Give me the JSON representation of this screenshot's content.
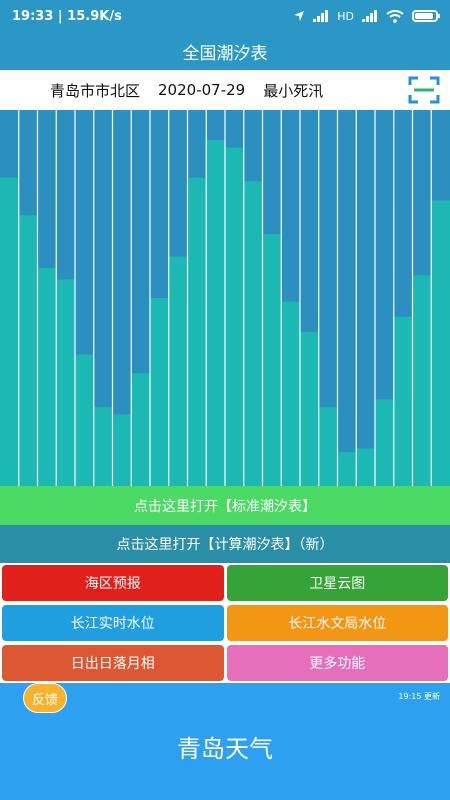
{
  "status": {
    "time_speed": "19:33 | 15.9K/s",
    "signal_text": "HD"
  },
  "app_title": "全国潮汐表",
  "info": {
    "location": "青岛市市北区",
    "date": "2020-07-29",
    "tide_type": "最小死汛"
  },
  "chart_data": {
    "type": "bar",
    "stacked": true,
    "bar_count": 24,
    "tide_levels": [
      0.82,
      0.72,
      0.58,
      0.55,
      0.35,
      0.21,
      0.19,
      0.3,
      0.5,
      0.61,
      0.82,
      0.92,
      0.9,
      0.81,
      0.67,
      0.49,
      0.41,
      0.21,
      0.09,
      0.1,
      0.23,
      0.45,
      0.56,
      0.76
    ],
    "colors": {
      "water": "#1bb8b4",
      "sky": "#2b90c0",
      "divider": "#ffffff"
    },
    "title": "",
    "xlabel": "",
    "ylabel": ""
  },
  "buttons": {
    "standard_table": "点击这里打开【标准潮汐表】",
    "calc_table": "点击这里打开【计算潮汐表】（新）"
  },
  "grid": [
    {
      "label": "海区预报",
      "color": "#e0201b"
    },
    {
      "label": "卫星云图",
      "color": "#36a338"
    },
    {
      "label": "长江实时水位",
      "color": "#1f9ee0"
    },
    {
      "label": "长江水文局水位",
      "color": "#f29613"
    },
    {
      "label": "日出日落月相",
      "color": "#dd5832"
    },
    {
      "label": "更多功能",
      "color": "#e66fbb"
    }
  ],
  "weather": {
    "feedback": "反馈",
    "update_time": "19:15 更新",
    "city": "青岛天气"
  }
}
